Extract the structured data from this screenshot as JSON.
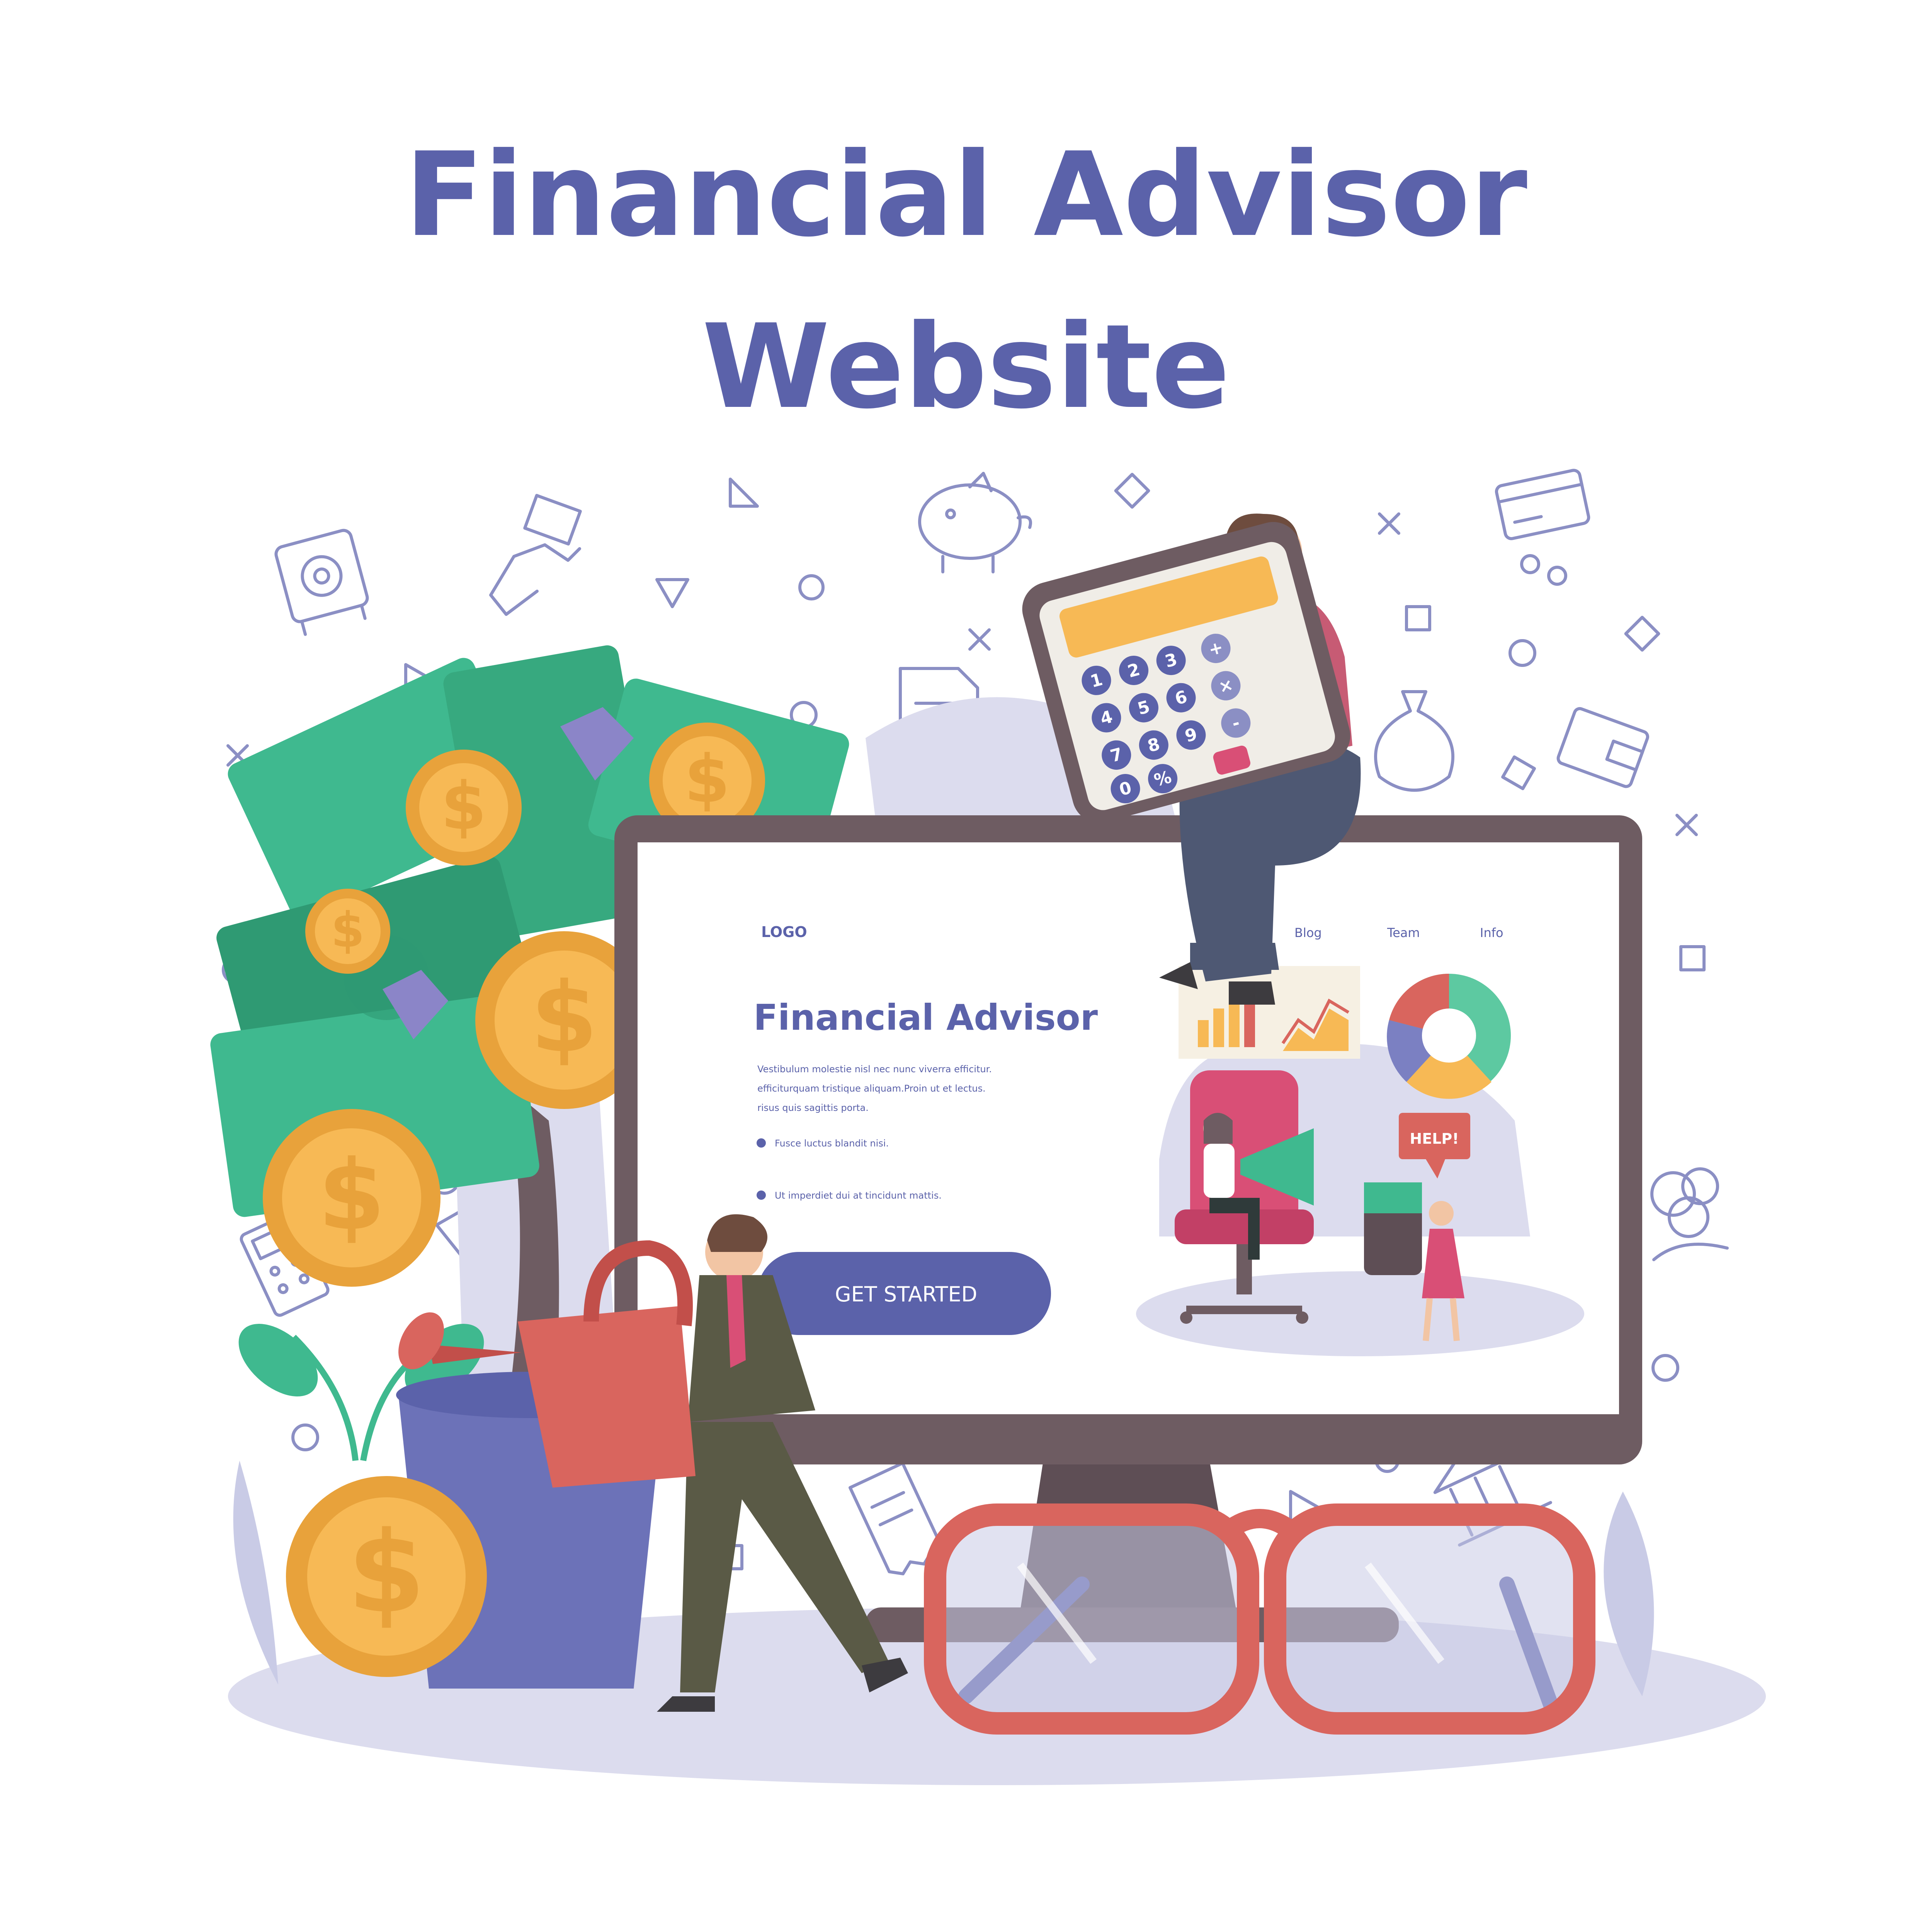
{
  "poster": {
    "title_line_1": "Financial Advisor",
    "title_line_2": "Website"
  },
  "website": {
    "logo": "LOGO",
    "nav": [
      "Blog",
      "Team",
      "Info"
    ],
    "heading": "Financial Advisor",
    "body_lines": [
      "Vestibulum molestie nisl nec nunc viverra efficitur.",
      "efficiturquam tristique aliquam.Proin ut et lectus.",
      "risus quis sagittis porta."
    ],
    "bullets": [
      "Fusce luctus blandit nisi.",
      "Ut imperdiet dui at tincidunt mattis."
    ],
    "cta_label": "GET STARTED",
    "help_bubble": "HELP!"
  },
  "calculator": {
    "keys": [
      "1",
      "2",
      "3",
      "4",
      "5",
      "6",
      "7",
      "8",
      "9",
      "0",
      "%",
      "+",
      "×",
      "-"
    ]
  },
  "colors": {
    "accent": "#5b62aa",
    "money_green": "#3fb98f",
    "coin_gold": "#f7b955",
    "monitor_frame": "#6e5c62",
    "glasses_red": "#d9655e",
    "backdrop_lavender": "#dcdcee"
  },
  "icons": [
    "safe-icon",
    "hand-money-icon",
    "piggy-bank-icon",
    "credit-card-icon",
    "money-bag-icon",
    "wallet-icon",
    "document-icon",
    "chart-icon",
    "bank-icon",
    "calculator-icon",
    "receipt-icon",
    "coins-icon"
  ]
}
